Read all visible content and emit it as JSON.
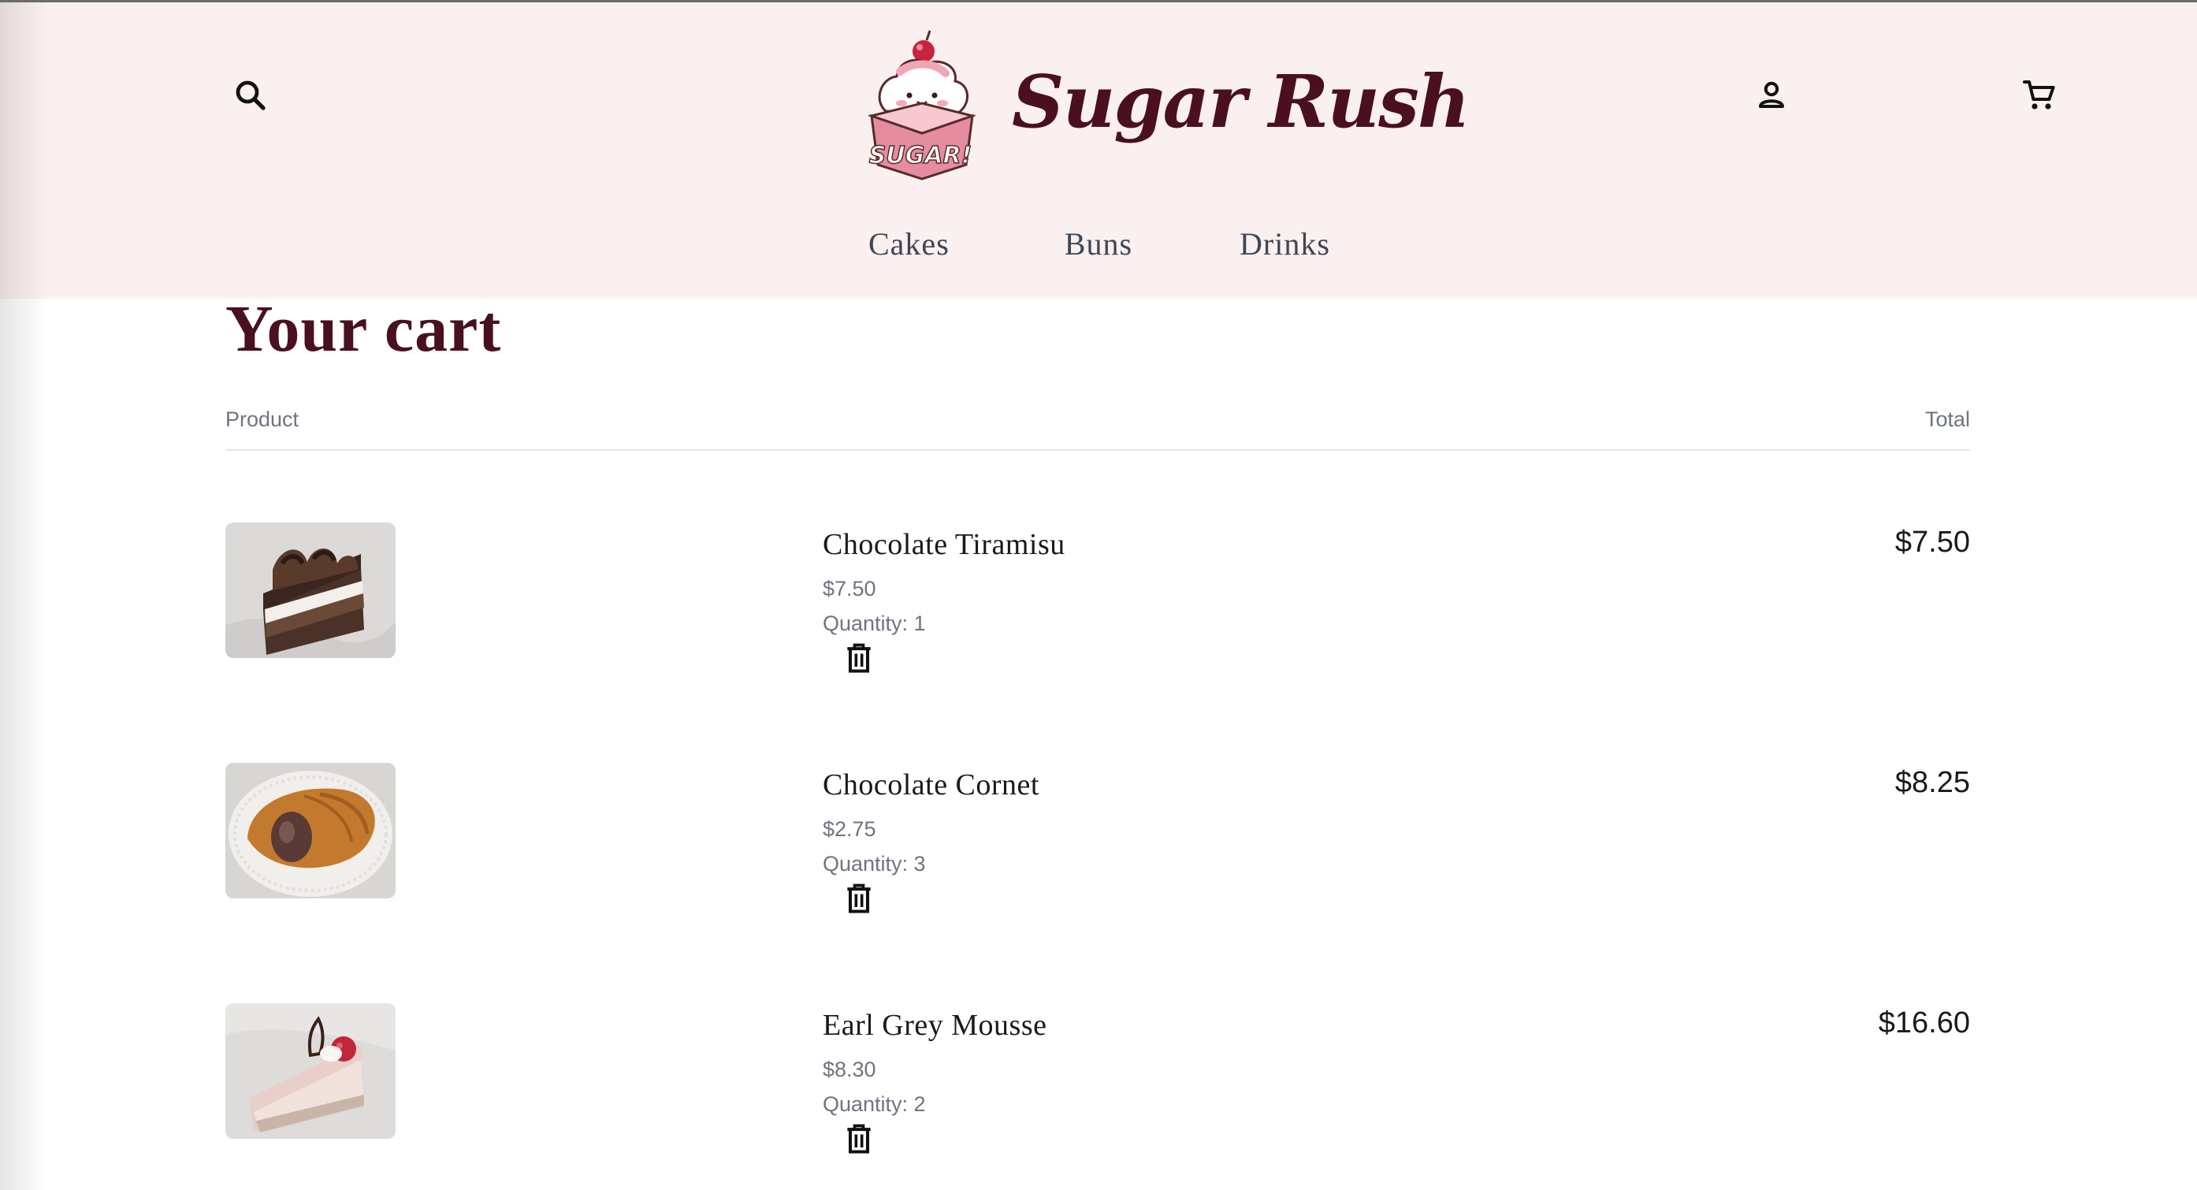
{
  "header": {
    "brand_name": "Sugar Rush",
    "logo_text": "SUGAR!",
    "nav": [
      {
        "label": "Cakes"
      },
      {
        "label": "Buns"
      },
      {
        "label": "Drinks"
      }
    ],
    "icons": [
      "search-icon",
      "account-icon",
      "cart-icon"
    ]
  },
  "cart": {
    "title": "Your cart",
    "columns": {
      "product": "Product",
      "total": "Total"
    },
    "items": [
      {
        "name": "Chocolate Tiramisu",
        "unit_price": "$7.50",
        "quantity_label": "Quantity: 1",
        "line_total": "$7.50"
      },
      {
        "name": "Chocolate Cornet",
        "unit_price": "$2.75",
        "quantity_label": "Quantity: 3",
        "line_total": "$8.25"
      },
      {
        "name": "Earl Grey Mousse",
        "unit_price": "$8.30",
        "quantity_label": "Quantity: 2",
        "line_total": "$16.60"
      }
    ]
  },
  "colors": {
    "header_bg": "#fbf0f0",
    "brand": "#4a1020",
    "nav_text": "#3d4656",
    "muted_text": "#6f7480"
  }
}
